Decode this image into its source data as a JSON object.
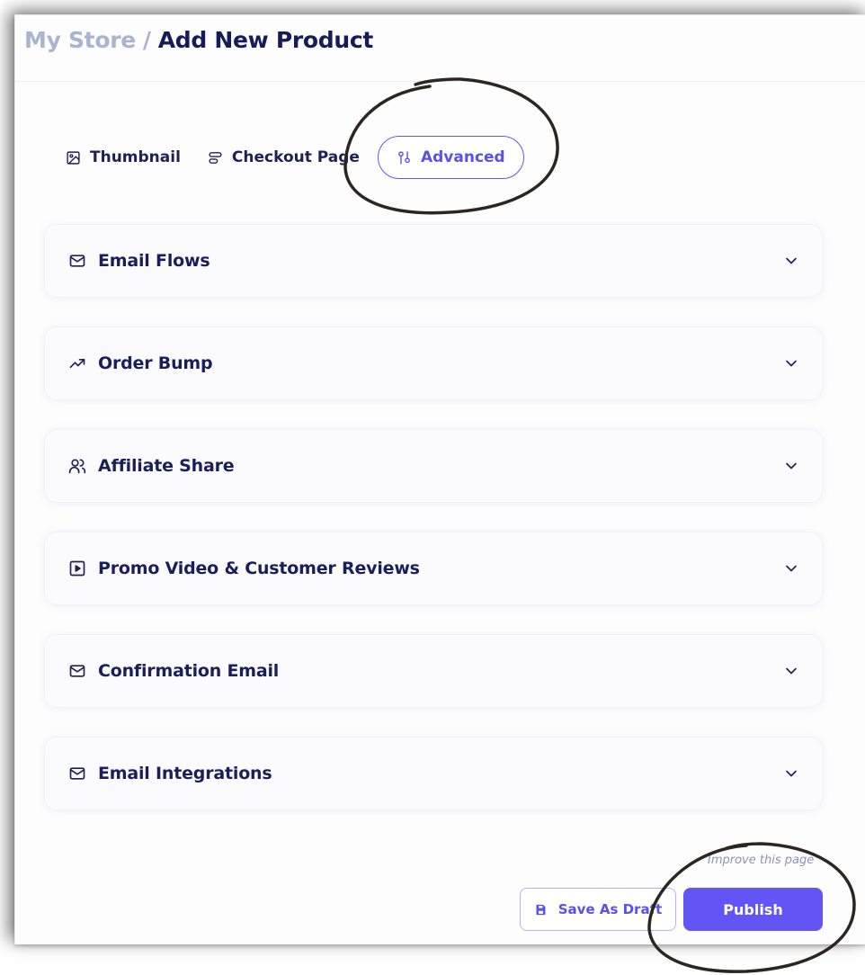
{
  "breadcrumb": {
    "root": "My Store",
    "separator": "/",
    "current": "Add New Product"
  },
  "tabs": [
    {
      "label": "Thumbnail",
      "icon": "image-icon"
    },
    {
      "label": "Checkout Page",
      "icon": "layout-icon"
    },
    {
      "label": "Advanced",
      "icon": "settings-sliders-icon",
      "active": true
    }
  ],
  "sections": [
    {
      "label": "Email Flows",
      "icon": "mail-icon"
    },
    {
      "label": "Order Bump",
      "icon": "trending-up-icon"
    },
    {
      "label": "Affiliate Share",
      "icon": "users-icon"
    },
    {
      "label": "Promo Video & Customer Reviews",
      "icon": "video-play-icon"
    },
    {
      "label": "Confirmation Email",
      "icon": "mail-icon"
    },
    {
      "label": "Email Integrations",
      "icon": "mail-icon"
    }
  ],
  "footer": {
    "improve_link": "Improve this page",
    "save_draft_label": "Save As Draft",
    "publish_label": "Publish"
  },
  "colors": {
    "accent": "#6355f5",
    "text": "#1a1f5c",
    "muted": "#a9b4d0"
  }
}
